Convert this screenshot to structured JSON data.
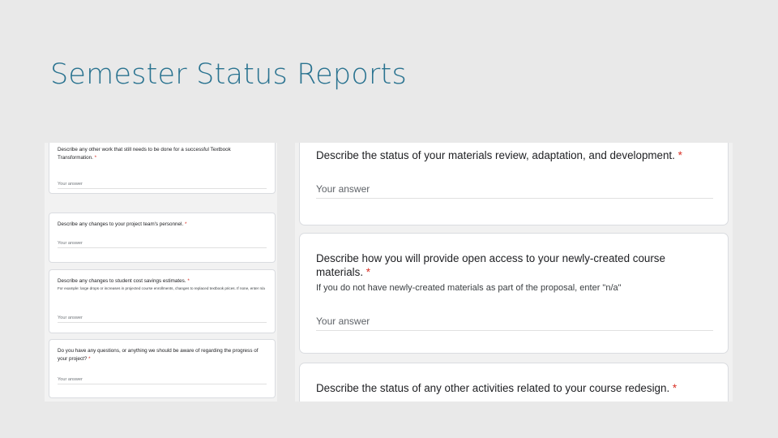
{
  "slide": {
    "title": "Semester Status Reports"
  },
  "left_form": {
    "questions": [
      {
        "text": "Describe any other work that still needs to be done for a successful Textbook Transformation.",
        "required": "*",
        "answer_placeholder": "Your answer"
      },
      {
        "text": "Describe any changes to your project team's personnel.",
        "required": "*",
        "answer_placeholder": "Your answer"
      },
      {
        "text": "Describe any changes to student cost savings estimates.",
        "required": "*",
        "help": "For example: large drops or increases in projected course enrollments, changes to replaced textbook prices. If none, enter n/a",
        "answer_placeholder": "Your answer"
      },
      {
        "text": "Do you have any questions, or anything we should be aware of regarding the progress of your project?",
        "required": "*",
        "answer_placeholder": "Your answer"
      }
    ]
  },
  "right_form": {
    "questions": [
      {
        "text": "Describe the status of your materials review, adaptation, and development.",
        "required": "*",
        "answer_placeholder": "Your answer"
      },
      {
        "text": "Describe how you will provide open access to your newly-created course materials.",
        "required": "*",
        "help": "If you do not have newly-created materials as part of the proposal, enter \"n/a\"",
        "answer_placeholder": "Your answer"
      },
      {
        "text": "Describe the status of any other activities related to your course redesign.",
        "required": "*"
      }
    ]
  },
  "colors": {
    "title": "#2a7390",
    "required": "#d93025",
    "background": "#e9e9e9"
  }
}
